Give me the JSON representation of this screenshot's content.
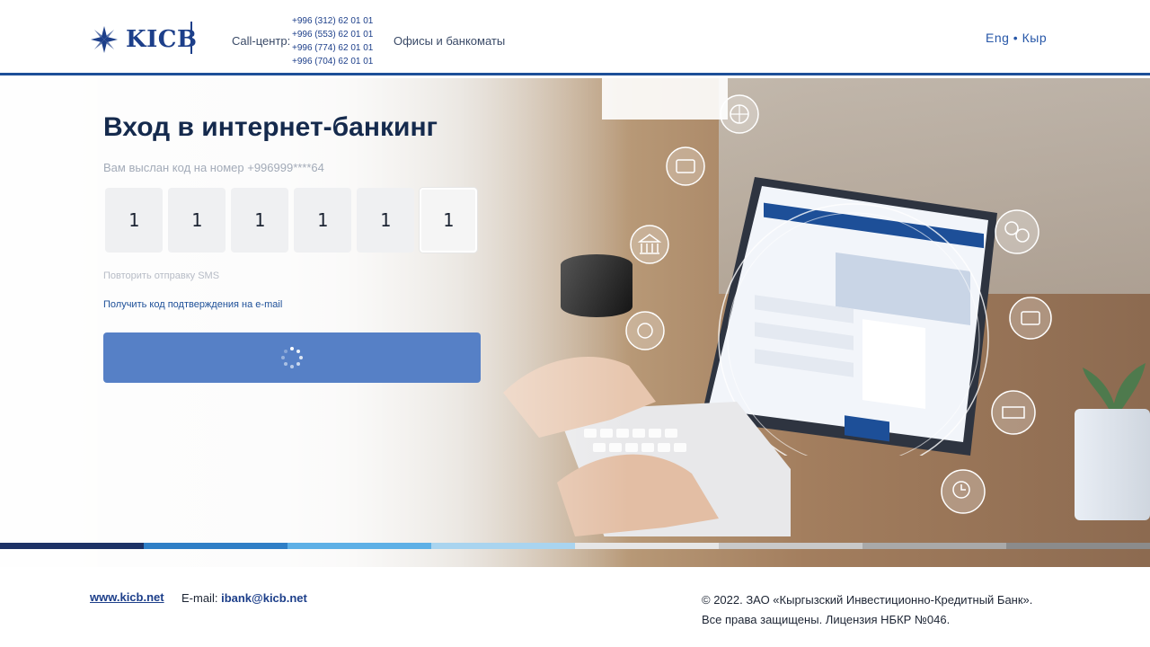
{
  "header": {
    "logo_text": "KICB",
    "callcenter_label": "Call-центр:",
    "phones": [
      "+996 (312) 62 01 01",
      "+996 (553) 62 01 01",
      "+996 (774) 62 01 01",
      "+996 (704) 62 01 01"
    ],
    "offices_link": "Офисы и банкоматы",
    "lang_eng": "Eng",
    "lang_sep": " • ",
    "lang_kyr": "Кыр"
  },
  "login": {
    "title": "Вход в интернет-банкинг",
    "subtitle": "Вам выслан код на номер +996999****64",
    "code_digits": [
      "1",
      "1",
      "1",
      "1",
      "1",
      "1"
    ],
    "resend_sms": "Повторить отправку SMS",
    "email_code_link": "Получить код подтверждения на e-mail",
    "submit_state": "loading"
  },
  "footer": {
    "site": "www.kicb.net",
    "email_label": "E-mail:",
    "email": "ibank@kicb.net",
    "copyright_line1": "© 2022. ЗАО «Кыргызский Инвестиционно-Кредитный Банк».",
    "copyright_line2": "Все права защищены. Лицензия НБКР №046."
  },
  "colors": {
    "brand_dark": "#1d3f8a",
    "button": "#5680c6",
    "stripe": [
      "#1d3266",
      "#2f7fc6",
      "#5eb0e6",
      "#a9d4ef",
      "#e6e6e6",
      "#c9c9c9",
      "#a9a9a9",
      "#8b8b8b"
    ]
  },
  "icons": [
    "kicb-logo-icon",
    "spinner-icon",
    "globe-icon",
    "cards-icon",
    "bank-icon",
    "money-icon",
    "currency-exchange-icon",
    "payment-icon",
    "check-icon",
    "clock-money-icon"
  ]
}
